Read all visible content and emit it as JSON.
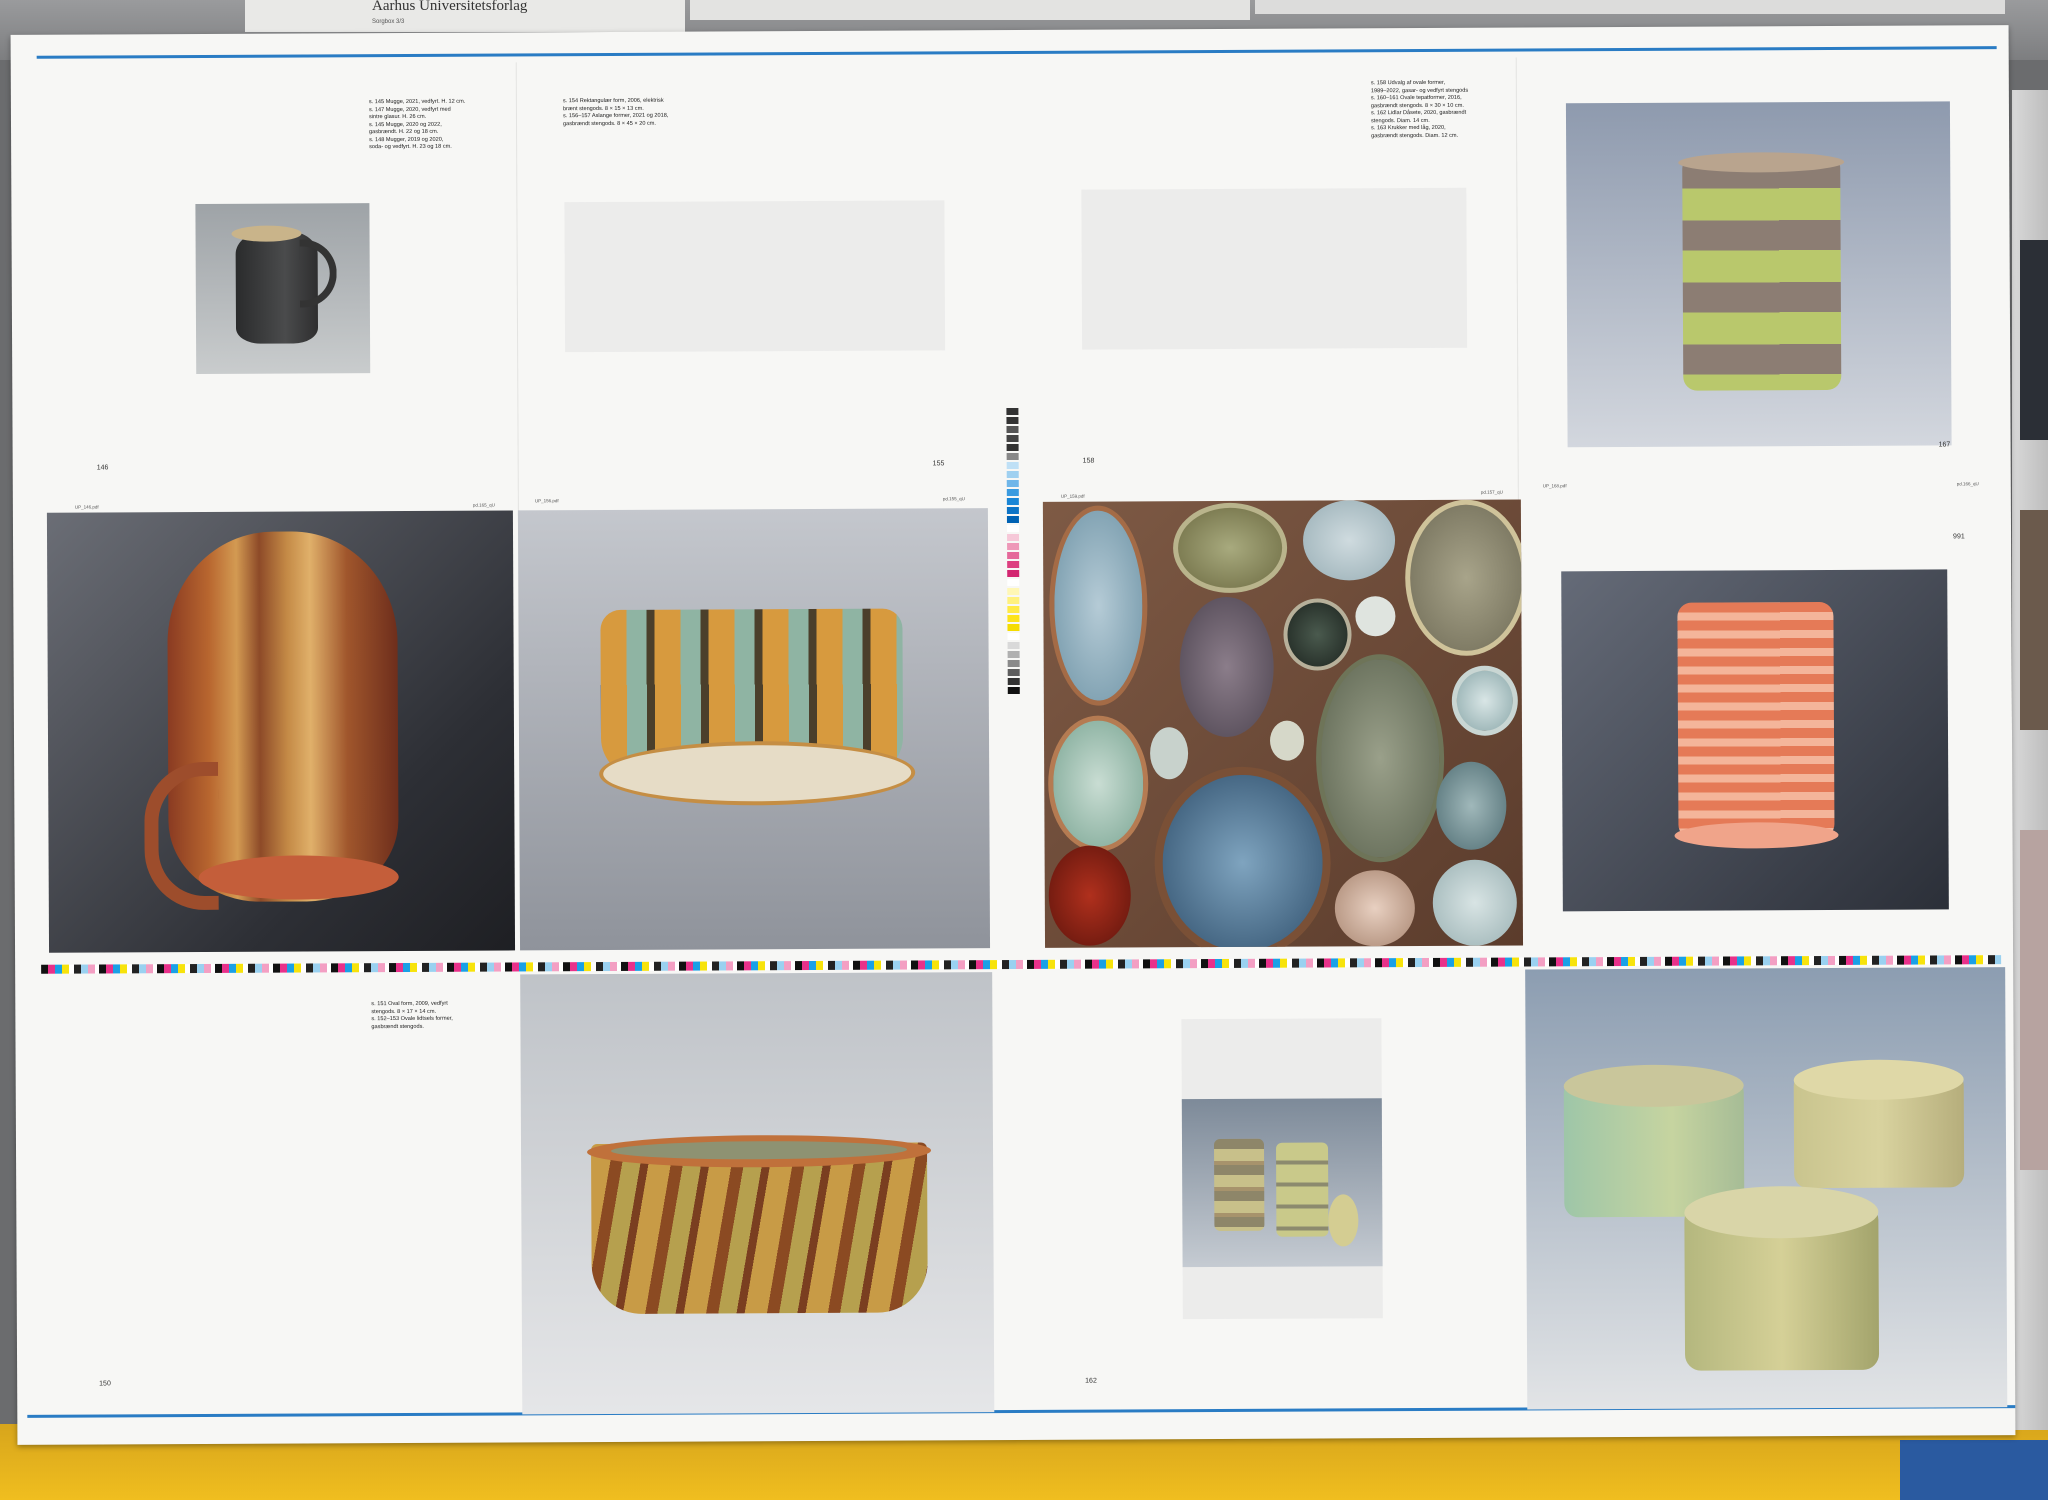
{
  "header": {
    "publisher": "Aarhus Universitetsforlag",
    "publisher_sub": "Sorgbox 3/3"
  },
  "captions": {
    "page146": "s. 145 Mugge, 2021, vedfyrt. H. 12 cm.\ns. 147 Mugge, 2020, vedfyrt med\nsintre glasur. H. 26 cm.\ns. 145 Mugge, 2020 og 2022,\ngasbrændt. H. 22 og 18 cm.\ns. 148 Mugger, 2019 og 2020,\nsoda- og vedfyrt. H. 23 og 18 cm.",
    "page154": "s. 154 Rektangulær form, 2006, elektrisk\nbrænt stengods. 8 × 15 × 13 cm.\ns. 156–157 Aslange former, 2021 og 2018,\ngasbrændt stengods. 8 × 45 × 20 cm.",
    "page158": "s. 158 Udvalg af ovale former,\n1989–2022, gasar- og vedfyrt stengods\ns. 160–161 Ovale tepatformer, 2016,\ngasbrændt stengods. 8 × 30 × 10 cm.\ns. 162 Lidlar Dåsete, 2020, gasbrændt\nstengods. Diam. 14 cm.\ns. 163 Krukker med låg, 2020,\ngasbrændt stengods. Diam. 12 cm.",
    "page150": "s. 151 Oval form, 2009, vedfyrt\nstengods. 8 × 17 × 14 cm.\ns. 152–153 Ovale lidtsels former,\ngasbrændt stengods."
  },
  "folios": {
    "p146": "146",
    "p155": "155",
    "p158": "158",
    "p167": "167",
    "p166": "991",
    "p150": "150",
    "p162": "162"
  },
  "filenames": {
    "f1": "UP_146.pdf",
    "f2": "pd.165_qU",
    "f3": "UP_156.pdf",
    "f4": "pd.155_qU",
    "f5": "UP_159.pdf",
    "f6": "pd.157_qU",
    "f7": "UP_168.pdf",
    "f8": "pd.166_qU"
  },
  "colors": {
    "accent_blue": "#2a7cc4",
    "paper": "#f7f7f5"
  }
}
